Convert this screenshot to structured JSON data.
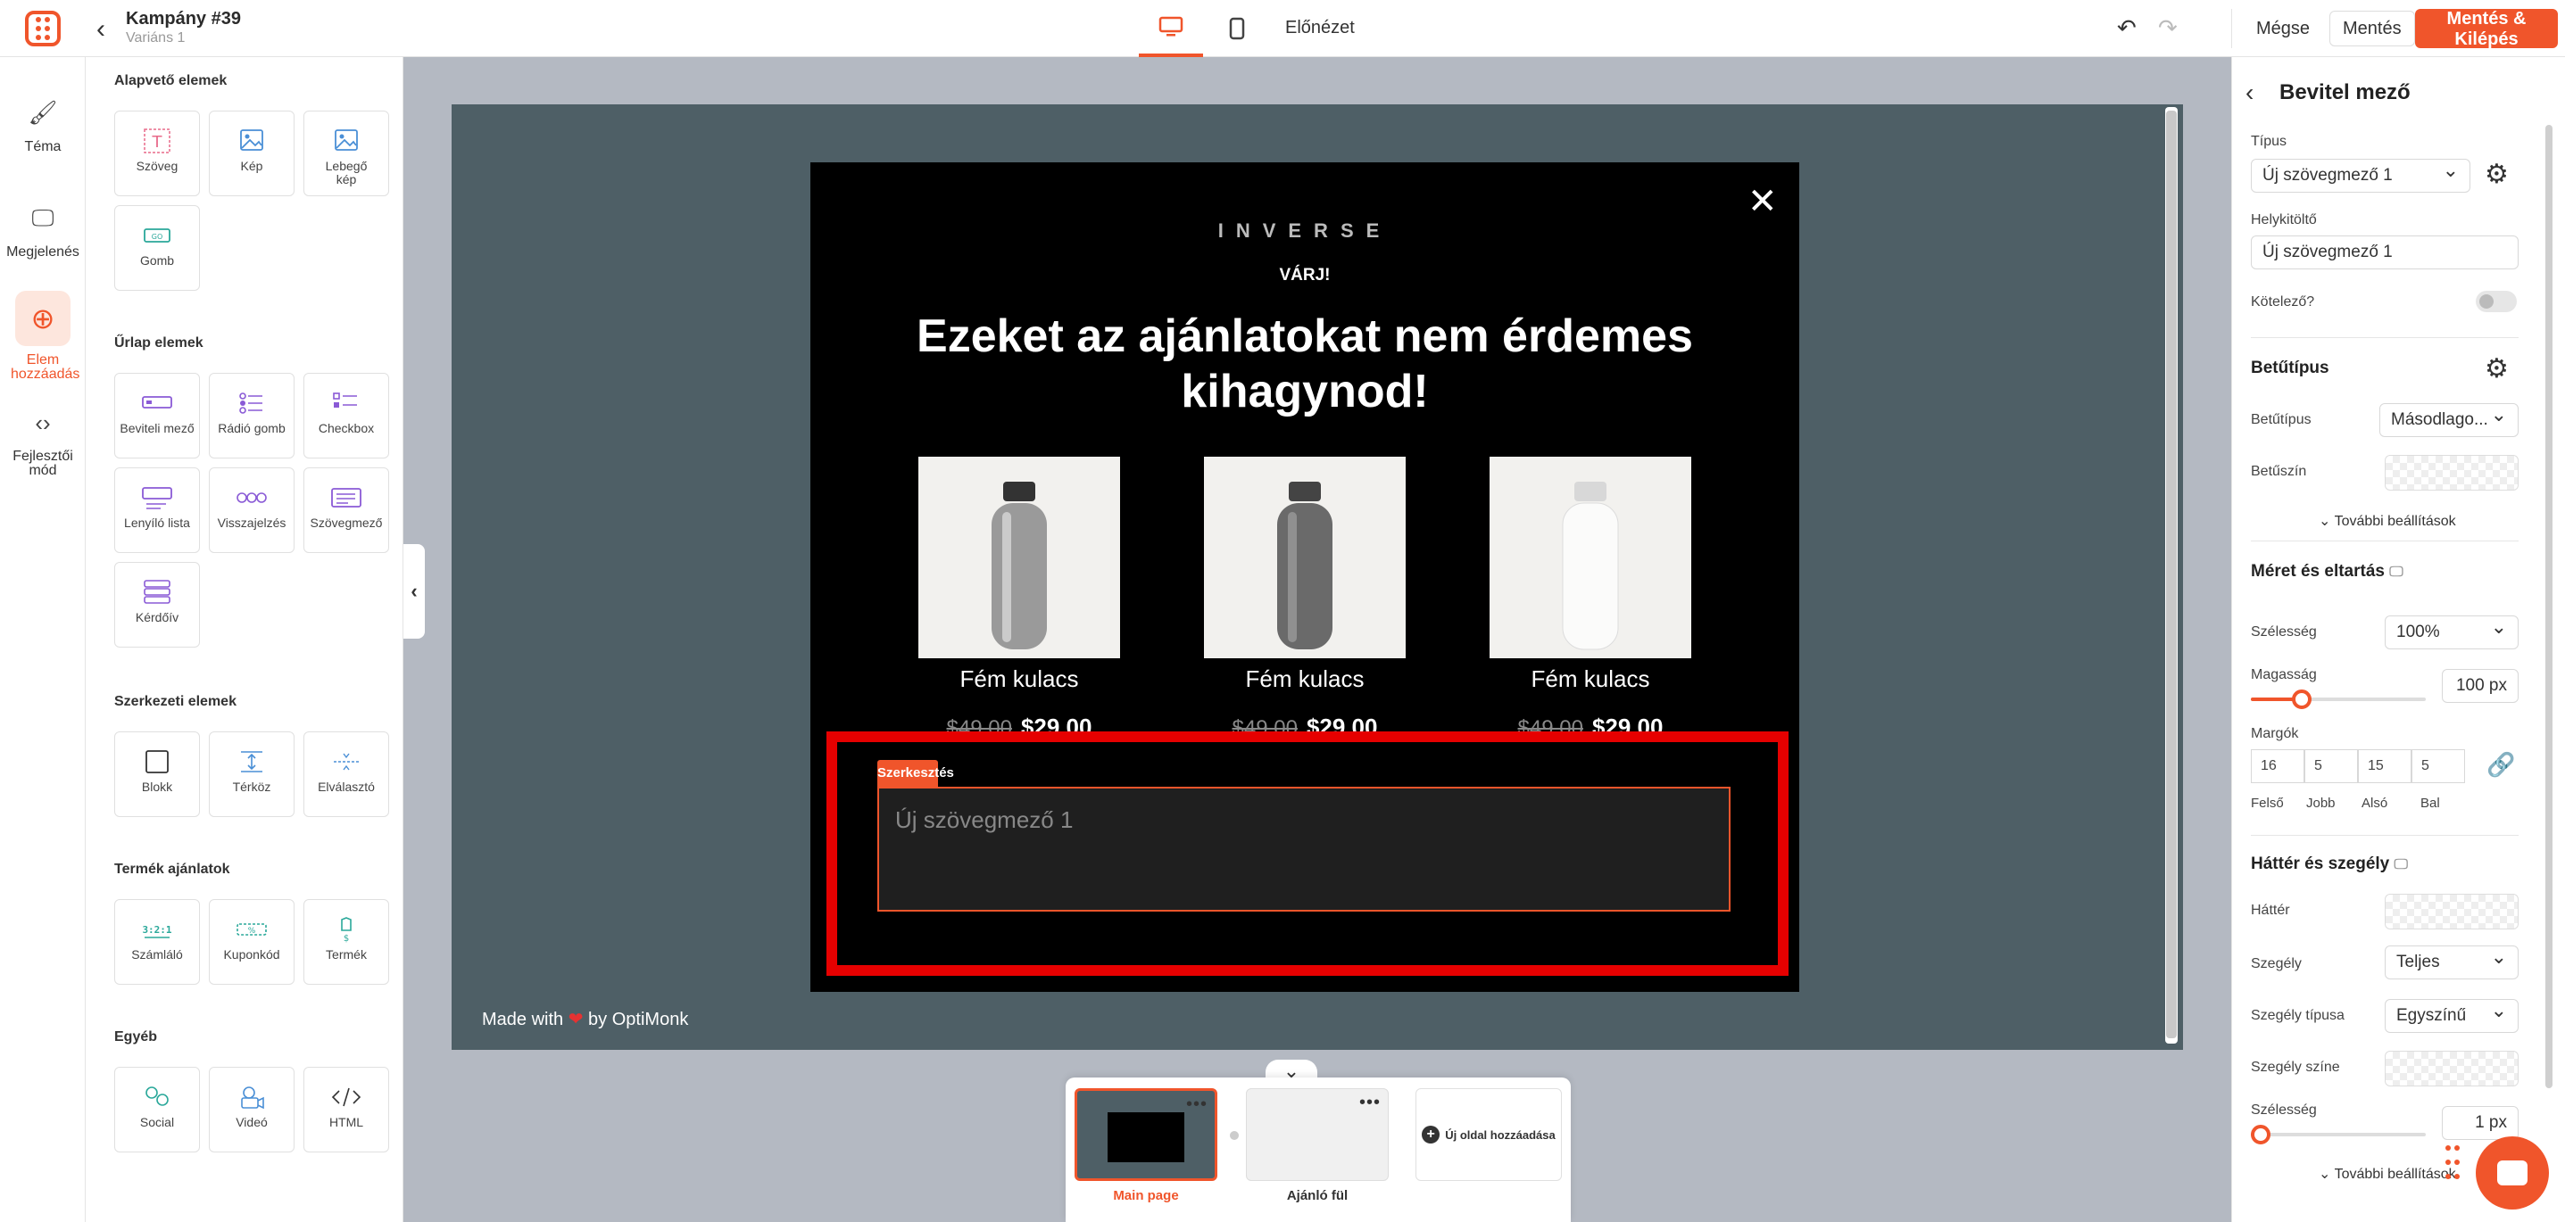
{
  "header": {
    "campaign_title": "Kampány #39",
    "variant": "Variáns 1",
    "preview": "Előnézet",
    "cancel": "Mégse",
    "save": "Mentés",
    "save_exit": "Mentés & Kilépés"
  },
  "rail": [
    {
      "label": "Téma",
      "icon": "paintbrush-icon"
    },
    {
      "label": "Megjelenés",
      "icon": "monitor-icon"
    },
    {
      "label": "Elem hozzáadás",
      "icon": "plus-circle-icon",
      "active": true
    },
    {
      "label": "Fejlesztői mód",
      "icon": "code-icon"
    }
  ],
  "palette": {
    "basic_title": "Alapvető elemek",
    "basic": [
      "Szöveg",
      "Kép",
      "Lebegő kép",
      "Gomb"
    ],
    "form_title": "Űrlap elemek",
    "form": [
      "Beviteli mező",
      "Rádió gomb",
      "Checkbox",
      "Lenyíló lista",
      "Visszajelzés",
      "Szövegmező",
      "Kérdőív"
    ],
    "struct_title": "Szerkezeti elemek",
    "struct": [
      "Blokk",
      "Térköz",
      "Elválasztó"
    ],
    "product_title": "Termék ajánlatok",
    "product": [
      "Számláló",
      "Kuponkód",
      "Termék"
    ],
    "other_title": "Egyéb",
    "other": [
      "Social",
      "Videó",
      "HTML"
    ],
    "go_badge": "GO",
    "counter_badge": "3:2:1"
  },
  "popup": {
    "brand": "INVERSE",
    "warn": "VÁRJ!",
    "headline": "Ezeket az ajánlatokat nem érdemes kihagynod!",
    "products": [
      {
        "name": "Fém kulacs",
        "old_price": "$49.00",
        "price": "$29.00",
        "color": "#9a9a9a"
      },
      {
        "name": "Fém kulacs",
        "old_price": "$49.00",
        "price": "$29.00",
        "color": "#6a6a6a"
      },
      {
        "name": "Fém kulacs",
        "old_price": "$49.00",
        "price": "$29.00",
        "color": "#ececea"
      }
    ],
    "edit_badge": "Szerkesztés",
    "input_placeholder": "Új szövegmező 1"
  },
  "stage": {
    "made_with_prefix": "Made with",
    "made_with_suffix": "by OptiMonk"
  },
  "pages": {
    "main": "Main page",
    "second": "Ajánló fül",
    "add": "Új oldal hozzáadása"
  },
  "props": {
    "title": "Bevitel mező",
    "type_label": "Típus",
    "type_value": "Új szövegmező 1",
    "placeholder_label": "Helykitöltő",
    "placeholder_value": "Új szövegmező 1",
    "required_label": "Kötelező?",
    "font_section": "Betűtípus",
    "font_label": "Betűtípus",
    "font_value": "Másodlago...",
    "font_color_label": "Betűszín",
    "more_settings": "További beállítások",
    "size_section": "Méret és eltartás",
    "width_label": "Szélesség",
    "width_value": "100%",
    "height_label": "Magasság",
    "height_value": "100 px",
    "margins_label": "Margók",
    "margins": [
      {
        "value": "16",
        "label": "Felső"
      },
      {
        "value": "5",
        "label": "Jobb"
      },
      {
        "value": "15",
        "label": "Alsó"
      },
      {
        "value": "5",
        "label": "Bal"
      }
    ],
    "bg_section": "Háttér és szegély",
    "bg_label": "Háttér",
    "border_label": "Szegély",
    "border_value": "Teljes",
    "border_type_label": "Szegély típusa",
    "border_type_value": "Egyszínű",
    "border_color_label": "Szegély színe",
    "border_width_label": "Szélesség",
    "border_width_value": "1 px",
    "more_settings_2": "További beállítások"
  },
  "colors": {
    "accent": "#f0552b",
    "stage": "#4e5f66",
    "highlight": "#e60000"
  }
}
